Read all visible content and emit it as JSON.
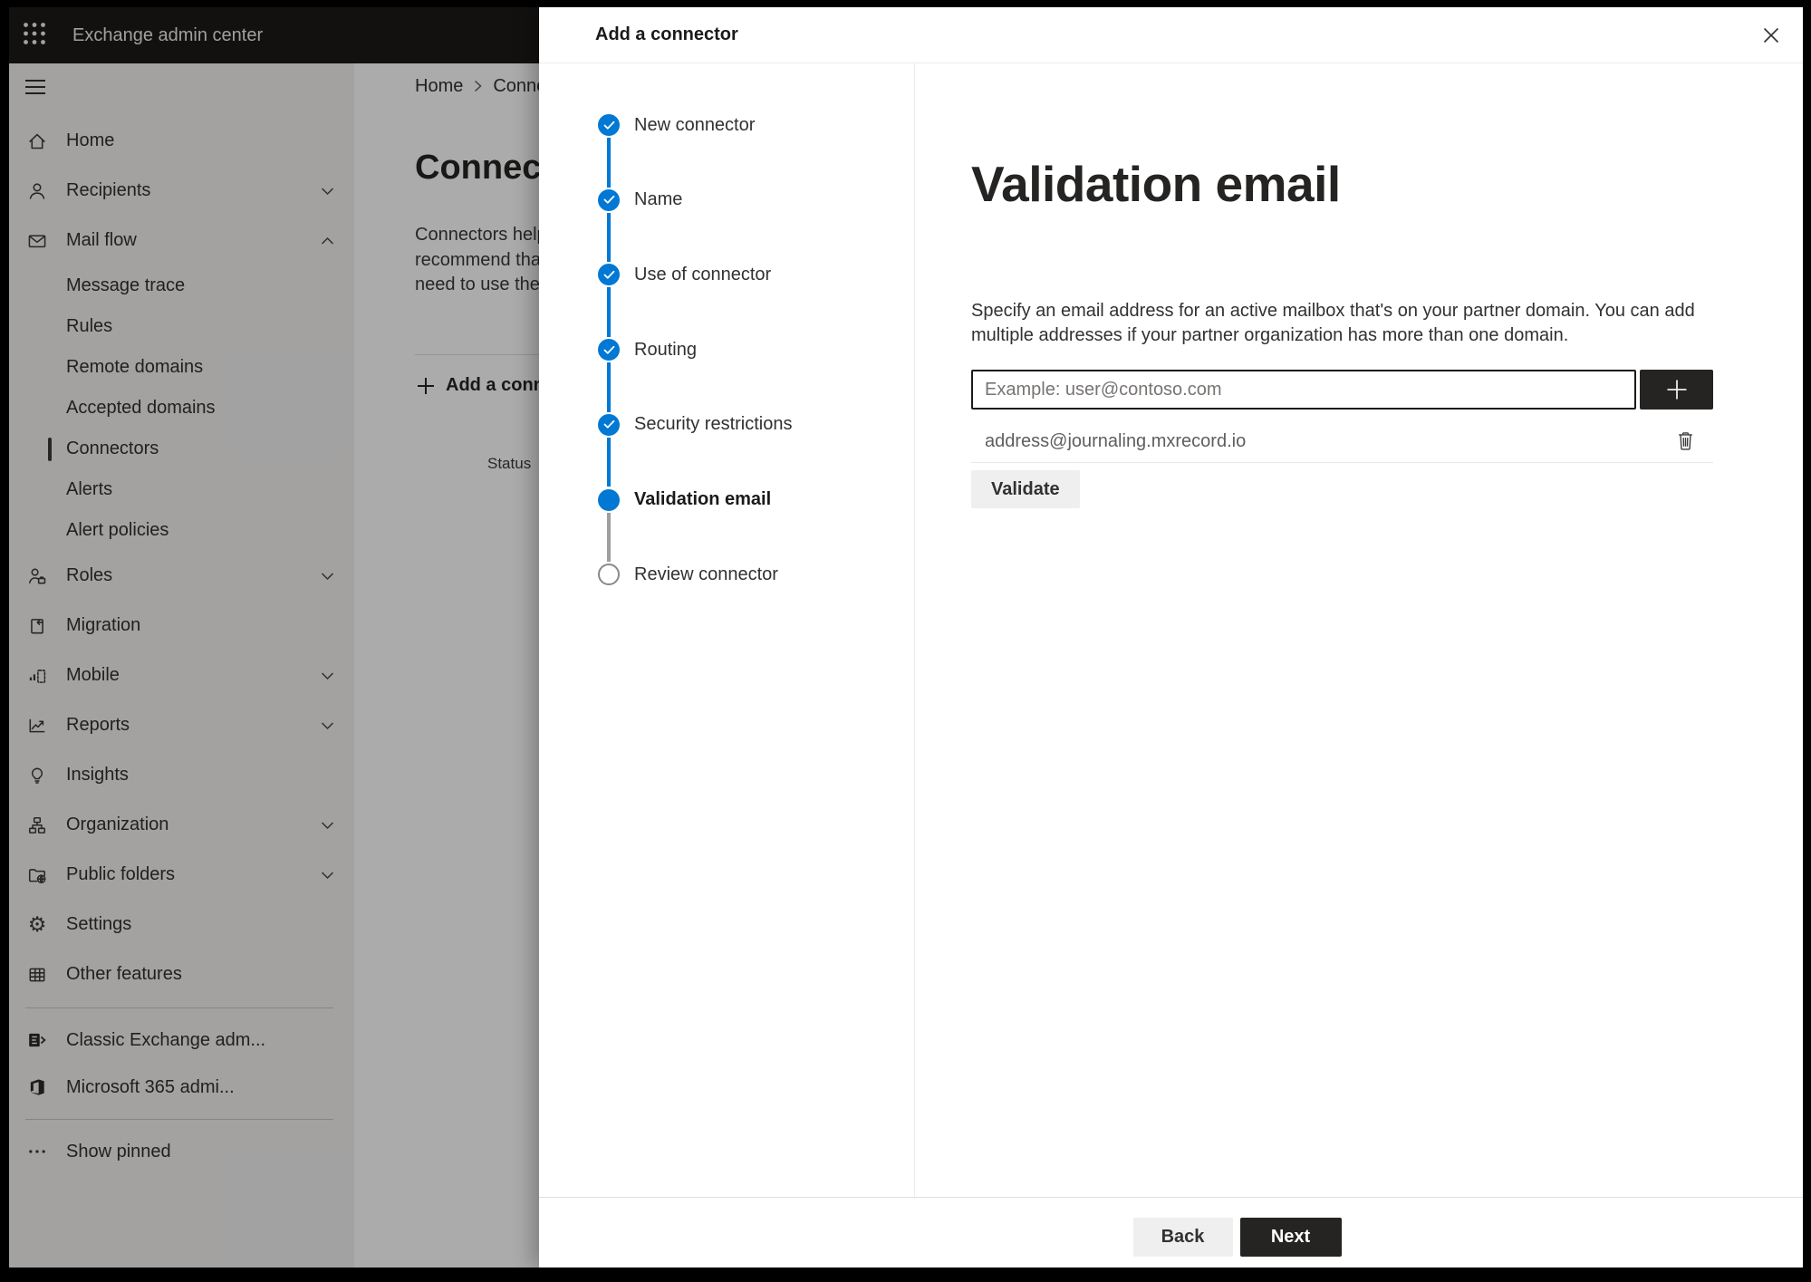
{
  "app": {
    "topbar": {
      "title": "Exchange admin center"
    }
  },
  "sidebar": {
    "items": [
      {
        "label": "Home",
        "icon": "home",
        "type": "top"
      },
      {
        "label": "Recipients",
        "icon": "person",
        "type": "top",
        "chevron": "down"
      },
      {
        "label": "Mail flow",
        "icon": "mail",
        "type": "top",
        "chevron": "up"
      },
      {
        "label": "Message trace",
        "type": "sub"
      },
      {
        "label": "Rules",
        "type": "sub"
      },
      {
        "label": "Remote domains",
        "type": "sub"
      },
      {
        "label": "Accepted domains",
        "type": "sub"
      },
      {
        "label": "Connectors",
        "type": "sub",
        "selected": true
      },
      {
        "label": "Alerts",
        "type": "sub"
      },
      {
        "label": "Alert policies",
        "type": "sub"
      },
      {
        "label": "Roles",
        "icon": "roles",
        "type": "top",
        "chevron": "down"
      },
      {
        "label": "Migration",
        "icon": "migration",
        "type": "top"
      },
      {
        "label": "Mobile",
        "icon": "mobile",
        "type": "top",
        "chevron": "down"
      },
      {
        "label": "Reports",
        "icon": "reports",
        "type": "top",
        "chevron": "down"
      },
      {
        "label": "Insights",
        "icon": "insights",
        "type": "top"
      },
      {
        "label": "Organization",
        "icon": "organization",
        "type": "top",
        "chevron": "down"
      },
      {
        "label": "Public folders",
        "icon": "public-folders",
        "type": "top",
        "chevron": "down"
      },
      {
        "label": "Settings",
        "icon": "settings",
        "type": "top"
      },
      {
        "label": "Other features",
        "icon": "other-features",
        "type": "top"
      },
      {
        "type": "separator"
      },
      {
        "label": "Classic Exchange adm...",
        "icon": "classic-exchange",
        "type": "footer"
      },
      {
        "label": "Microsoft 365 admi...",
        "icon": "microsoft-365",
        "type": "footer"
      },
      {
        "type": "separator"
      },
      {
        "label": "Show pinned",
        "icon": "ellipsis",
        "type": "footer"
      }
    ]
  },
  "page": {
    "breadcrumb": [
      "Home",
      "Conne"
    ],
    "title": "Connect",
    "intro_lines": [
      "Connectors help",
      "recommend that",
      "need to use ther"
    ],
    "add_button_label": "Add a conn",
    "table": {
      "header": "Status"
    }
  },
  "modal": {
    "title": "Add a connector",
    "steps": [
      {
        "label": "New connector",
        "state": "complete"
      },
      {
        "label": "Name",
        "state": "complete"
      },
      {
        "label": "Use of connector",
        "state": "complete"
      },
      {
        "label": "Routing",
        "state": "complete"
      },
      {
        "label": "Security restrictions",
        "state": "complete"
      },
      {
        "label": "Validation email",
        "state": "current"
      },
      {
        "label": "Review connector",
        "state": "upcoming"
      }
    ],
    "content": {
      "heading": "Validation email",
      "description_lines": [
        "Specify an email address for an active mailbox that's on your partner domain. You can add",
        "multiple addresses if your partner organization has more than one domain."
      ],
      "input_placeholder": "Example: user@contoso.com",
      "input_value": "",
      "addresses": [
        "address@journaling.mxrecord.io"
      ],
      "validate_label": "Validate"
    },
    "footer": {
      "back_label": "Back",
      "next_label": "Next"
    }
  },
  "colors": {
    "accent": "#0078d4",
    "topbar_bg": "#1b1a19",
    "sidebar_bg": "#f3f2f1",
    "primary_button_bg": "#252423",
    "secondary_button_bg": "#efefef"
  }
}
